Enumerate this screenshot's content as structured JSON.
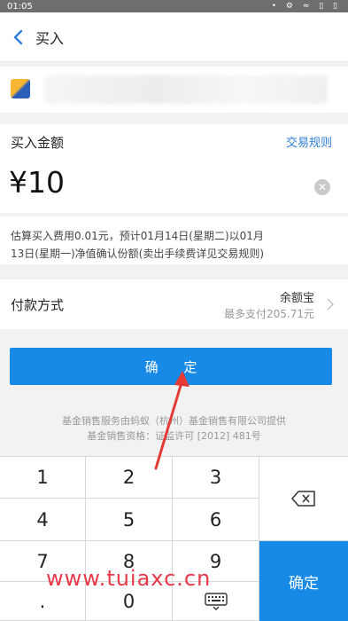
{
  "status_bar": {
    "time": "01:05",
    "icons": "• ⚙ ≈ ▯ ▯"
  },
  "nav": {
    "title": "买入"
  },
  "amount": {
    "label": "买入金额",
    "rules_link": "交易规则",
    "value": "¥10"
  },
  "estimate": {
    "line1": "估算买入费用0.01元，预计01月14日(星期二)以01月",
    "line2": "13日(星期一)净值确认份额(卖出手续费详见交易规则)"
  },
  "payment": {
    "label": "付款方式",
    "method": "余额宝",
    "limit": "最多支付205.71元"
  },
  "confirm_button": "确 定",
  "disclaimer": {
    "line1": "基金销售服务由蚂蚁（杭州）基金销售有限公司提供",
    "line2": "基金销售资格：证监许可 [2012] 481号"
  },
  "keypad": {
    "keys": [
      "1",
      "2",
      "3",
      "4",
      "5",
      "6",
      "7",
      "8",
      "9",
      ".",
      "0"
    ],
    "confirm": "确定"
  },
  "watermark": "www.tuiaxc.cn",
  "colors": {
    "accent": "#1789e6",
    "link": "#2f7fd8",
    "watermark": "#e8394a"
  }
}
